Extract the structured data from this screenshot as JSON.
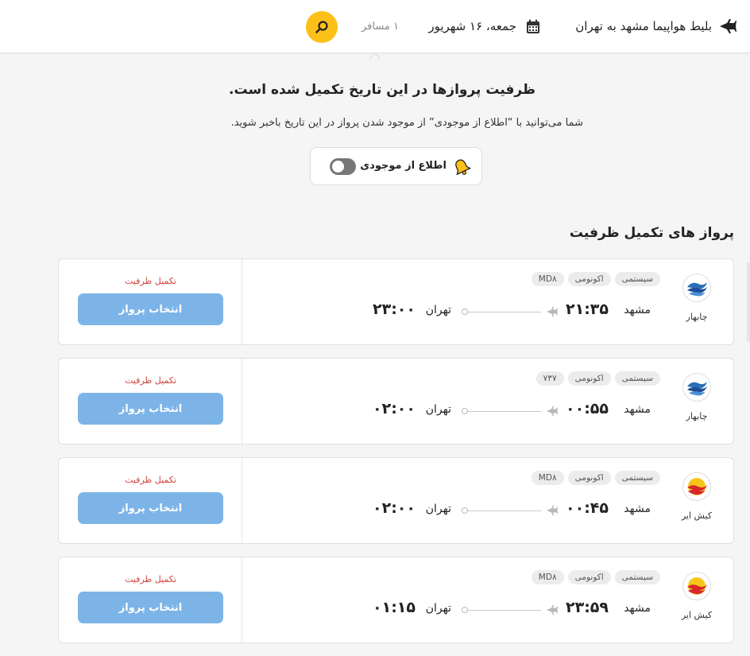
{
  "header": {
    "route_title": "بلیط هواپیما مشهد به تهران",
    "date": "جمعه، ۱۶ شهریور",
    "passengers": "۱ مسافر",
    "plane_icon": "airplane-icon",
    "calendar_icon": "calendar-icon",
    "search_icon": "search-icon",
    "accent_color": "#fcc018"
  },
  "notice": {
    "title": "ظرفیت پروازها در این تاریخ تکمیل شده است.",
    "subtitle": "شما می‌توانید با “اطلاع از موجودی” از موجود شدن پرواز در این تاریخ باخبر شوید.",
    "notify_label": "اطلاع از موجودی",
    "notify_enabled": false,
    "bell_icon": "bell-icon"
  },
  "section_title": "پرواز های تکمیل ظرفیت",
  "flights": [
    {
      "airline": "چابهار",
      "logo": "chabahar-logo",
      "tags": [
        "سیستمی",
        "اکونومی",
        "MD۸"
      ],
      "origin_city": "مشهد",
      "departure_time": "۲۱:۳۵",
      "destination_city": "تهران",
      "arrival_time": "۲۳:۰۰",
      "status": "تکمیل ظرفیت",
      "select_label": "انتخاب پرواز"
    },
    {
      "airline": "چابهار",
      "logo": "chabahar-logo",
      "tags": [
        "سیستمی",
        "اکونومی",
        "۷۳۷"
      ],
      "origin_city": "مشهد",
      "departure_time": "۰۰:۵۵",
      "destination_city": "تهران",
      "arrival_time": "۰۲:۰۰",
      "status": "تکمیل ظرفیت",
      "select_label": "انتخاب پرواز"
    },
    {
      "airline": "کیش ایر",
      "logo": "kish-air-logo",
      "tags": [
        "سیستمی",
        "اکونومی",
        "MD۸"
      ],
      "origin_city": "مشهد",
      "departure_time": "۰۰:۴۵",
      "destination_city": "تهران",
      "arrival_time": "۰۲:۰۰",
      "status": "تکمیل ظرفیت",
      "select_label": "انتخاب پرواز"
    },
    {
      "airline": "کیش ایر",
      "logo": "kish-air-logo",
      "tags": [
        "سیستمی",
        "اکونومی",
        "MD۸"
      ],
      "origin_city": "مشهد",
      "departure_time": "۲۳:۵۹",
      "destination_city": "تهران",
      "arrival_time": "۰۱:۱۵",
      "status": "تکمیل ظرفیت",
      "select_label": "انتخاب پرواز"
    }
  ],
  "colors": {
    "status_red": "#d0453f",
    "button_blue": "#7db4e8"
  }
}
